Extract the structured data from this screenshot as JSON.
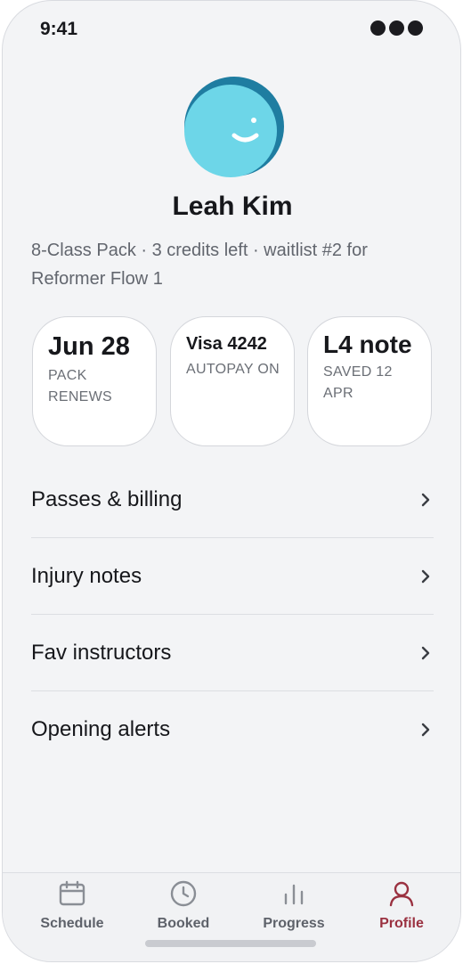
{
  "status_bar": {
    "time": "9:41"
  },
  "profile": {
    "name": "Leah Kim",
    "summary": "8-Class Pack · 3 credits left · waitlist #2 for Reformer Flow 1",
    "avatar_colors": {
      "ring": "#1f7da1",
      "face": "#6dd6e8",
      "smile": "#ffffff"
    }
  },
  "cards": [
    {
      "value": "Jun 28",
      "label": "PACK RENEWS"
    },
    {
      "value": "Visa 4242",
      "label": "AUTOPAY ON"
    },
    {
      "value": "L4 note",
      "label": "SAVED 12 APR"
    }
  ],
  "menu": [
    {
      "label": "Passes & billing",
      "icon": "chevron-right-icon"
    },
    {
      "label": "Injury notes",
      "icon": "chevron-right-icon"
    },
    {
      "label": "Fav instructors",
      "icon": "chevron-right-icon"
    },
    {
      "label": "Opening alerts",
      "icon": "chevron-right-icon"
    }
  ],
  "tabs": [
    {
      "label": "Schedule",
      "icon": "calendar-icon",
      "active": false
    },
    {
      "label": "Booked",
      "icon": "clock-icon",
      "active": false
    },
    {
      "label": "Progress",
      "icon": "bar-chart-icon",
      "active": false
    },
    {
      "label": "Profile",
      "icon": "person-icon",
      "active": true
    }
  ],
  "colors": {
    "accent": "#9a3140",
    "inactive_tab": "#8a8e95"
  }
}
